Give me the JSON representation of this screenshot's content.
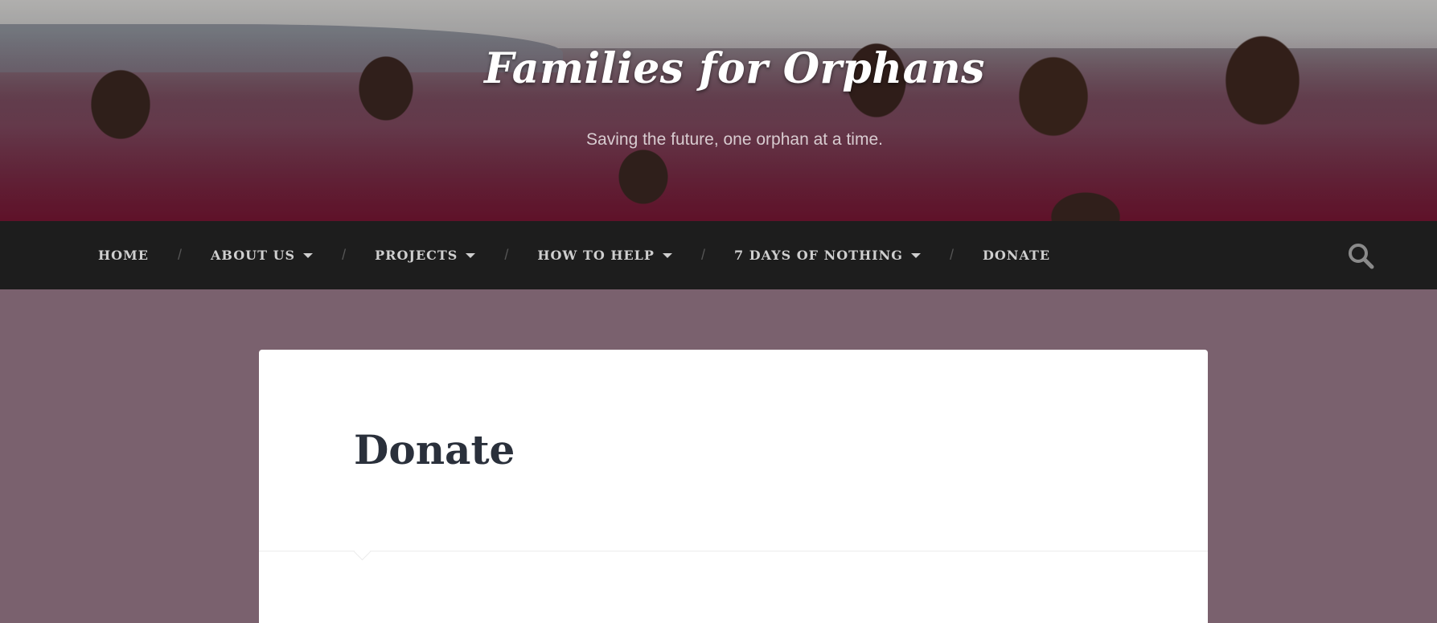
{
  "site": {
    "title": "Families for Orphans",
    "tagline": "Saving the future, one orphan at a time."
  },
  "nav": {
    "items": [
      {
        "label": "HOME",
        "has_dropdown": false
      },
      {
        "label": "ABOUT US",
        "has_dropdown": true
      },
      {
        "label": "PROJECTS",
        "has_dropdown": true
      },
      {
        "label": "HOW TO HELP",
        "has_dropdown": true
      },
      {
        "label": "7 DAYS OF NOTHING",
        "has_dropdown": true
      },
      {
        "label": "DONATE",
        "has_dropdown": false
      }
    ],
    "separator": "/",
    "search_icon": "search-icon"
  },
  "page": {
    "title": "Donate"
  },
  "colors": {
    "background": "#7a616e",
    "navbar": "#1d1d1d",
    "nav_text": "#cfcfcf",
    "card": "#ffffff",
    "title_text": "#2a303b"
  }
}
